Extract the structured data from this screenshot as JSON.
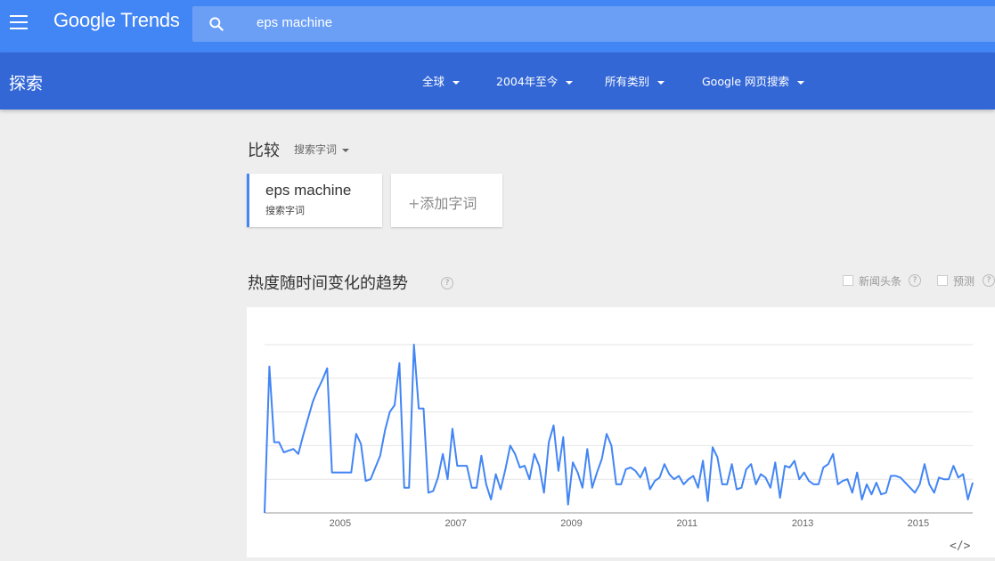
{
  "topbar": {
    "logo": "Google Trends",
    "search_value": "eps machine"
  },
  "subbar": {
    "title": "探索",
    "filters": [
      "全球",
      "2004年至今",
      "所有类别",
      "Google 网页搜索"
    ]
  },
  "compare": {
    "title": "比较",
    "type_label": "搜索字词",
    "term": {
      "name": "eps machine",
      "sub": "搜索字词"
    },
    "add_label": "添加字词",
    "add_plus": "+"
  },
  "interest": {
    "title": "热度随时间变化的趋势",
    "help": "?",
    "headlines_label": "新闻头条",
    "forecast_label": "预测"
  },
  "embed_label": "</>",
  "colors": {
    "topbar": "#4285f4",
    "subbar": "#3367d6",
    "line": "#4285f4"
  },
  "chart_data": {
    "type": "line",
    "title": "",
    "xlabel": "",
    "ylabel": "",
    "grid": true,
    "ylim": [
      0,
      100
    ],
    "x_start": "2004-01",
    "x_step": "month",
    "x_ticks": [
      "2005",
      "2007",
      "2009",
      "2011",
      "2013",
      "2015"
    ],
    "series": [
      {
        "values": [
          0,
          87,
          42,
          42,
          36,
          37,
          38,
          35,
          46,
          56,
          66,
          73,
          79,
          86,
          24,
          24,
          24,
          24,
          24,
          47,
          41,
          19,
          20,
          27,
          34,
          49,
          60,
          64,
          89,
          15,
          15,
          100,
          62,
          62,
          12,
          13,
          21,
          35,
          20,
          50,
          28,
          28,
          28,
          15,
          15,
          34,
          17,
          8,
          23,
          14,
          26,
          40,
          35,
          27,
          28,
          20,
          35,
          28,
          12,
          42,
          52,
          25,
          45,
          5,
          30,
          24,
          15,
          38,
          15,
          24,
          32,
          47,
          40,
          17,
          17,
          26,
          27,
          25,
          21,
          27,
          14,
          19,
          21,
          29,
          23,
          20,
          22,
          17,
          20,
          22,
          15,
          31,
          7,
          39,
          33,
          17,
          17,
          29,
          14,
          15,
          26,
          29,
          17,
          23,
          21,
          15,
          30,
          9,
          28,
          27,
          31,
          20,
          24,
          19,
          17,
          17,
          27,
          29,
          35,
          17,
          19,
          20,
          12,
          24,
          8,
          17,
          11,
          18,
          11,
          12,
          22,
          22,
          21,
          18,
          15,
          12,
          17,
          29,
          17,
          12,
          21,
          20,
          20,
          28,
          21,
          23,
          8,
          18
        ]
      }
    ]
  }
}
